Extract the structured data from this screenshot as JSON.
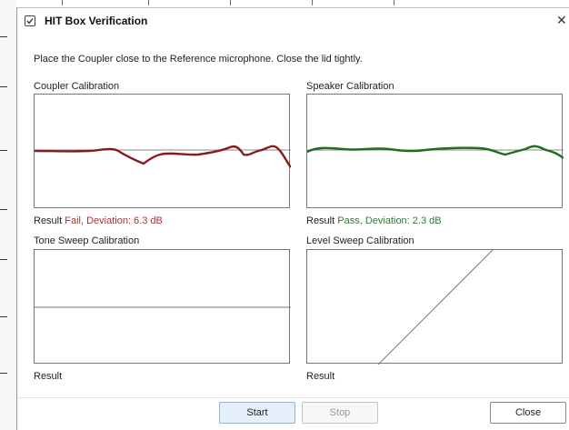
{
  "window": {
    "title": "HIT Box Verification"
  },
  "instruction": "Place the Coupler close to the Reference microphone. Close the lid tightly.",
  "panels": {
    "coupler": {
      "label": "Coupler Calibration",
      "result_label": "Result",
      "result_text": "Fail, Deviation: 6.3 dB",
      "result_status": "fail",
      "line_color": "#8b1a1a"
    },
    "speaker": {
      "label": "Speaker Calibration",
      "result_label": "Result",
      "result_text": "Pass, Deviation: 2.3 dB",
      "result_status": "pass",
      "line_color": "#1f6e1f"
    },
    "tone_sweep": {
      "label": "Tone Sweep Calibration",
      "result_label": "Result",
      "result_text": ""
    },
    "level_sweep": {
      "label": "Level Sweep Calibration",
      "result_label": "Result",
      "result_text": ""
    }
  },
  "buttons": {
    "start": "Start",
    "stop": "Stop",
    "close": "Close"
  },
  "icons": {
    "window": "checkbox-icon",
    "close": "close-icon"
  },
  "colors": {
    "fail": "#a83232",
    "pass": "#2f7d2f",
    "primary_button_bg": "#e6f0fb"
  }
}
